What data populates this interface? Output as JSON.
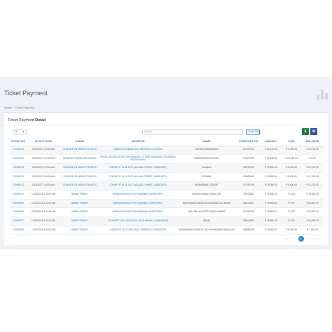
{
  "page": {
    "title": "Ticket Payment",
    "breadcrumb": {
      "home": "Home",
      "separator": "/",
      "current": "Ticket Payment"
    }
  },
  "card": {
    "title_prefix": "Ticket Payment",
    "title_bold": "Detail"
  },
  "controls": {
    "page_size": "10",
    "search_placeholder": "Search",
    "show_all_label": "Show All",
    "excel_icon": "excel-icon",
    "word_icon": "word-icon",
    "excel_glyph": "X",
    "word_glyph": "W"
  },
  "table": {
    "headers": [
      "TICKET NO",
      "FLIGHT DATE",
      "AGENT",
      "SPONSOR",
      "NAME",
      "PASSPORT NO",
      "AMOUNT",
      "PAID",
      "BALANCE"
    ],
    "rows": [
      {
        "ticket": "TCK00016",
        "date": "1/18/2017 2:10:00 AM",
        "agent": "SUNRISE VS AKBAR TRAVELS",
        "sponsor": "ABDULLAH ABDUL AZIZ IBRAHIM AL-JOHANI",
        "name": "FARHAN MAHAMBAN",
        "passport": "M1017922",
        "amount": "₹ 22,110.00",
        "paid": "₹ 2,400.00",
        "balance": "₹ 19,710.00"
      },
      {
        "ticket": "TCK00015",
        "date": "1/18/2017 7:40:00 AM",
        "agent": "SUNRISE TOURS AND TRAVEL",
        "sponsor": "FAISAL BIN MAHDOOR BIN MANNA AL-OTAIBI (MADINAH C/O AHMAD SALEEM ANS)",
        "name": "NAZAIR BEGUM KHAN",
        "passport": "P3027049",
        "amount": "₹ 25,246.00",
        "paid": "₹ 25,246.00",
        "balance": "₹ 0.00"
      },
      {
        "ticket": "TCK00014",
        "date": "1/18/2017 2:10:00 AM",
        "agent": "SUNRISE VS AKBAR TRAVELS",
        "sponsor": "LODHA PP 16.01.2017 (AN AJUL THREE CANDIDATE)",
        "name": "SALMAN",
        "passport": "H8752543",
        "amount": "₹ 20,300.00",
        "paid": "₹ 8,600.00",
        "balance": "₹ 11,700.00"
      },
      {
        "ticket": "TCK00013",
        "date": "1/18/2017 2:10:00 AM",
        "agent": "SUNRISE VS AKBAR TRAVELS",
        "sponsor": "LODHA PP 16.01.2017 (AN AJUL THREE CANDIDATE)",
        "name": "RIZWAN",
        "passport": "N3865460",
        "amount": "₹ 20,300.00",
        "paid": "₹ 8,600.00",
        "balance": "₹ 11,700.00"
      },
      {
        "ticket": "TCK00012",
        "date": "1/18/2017 2:10:00 AM",
        "agent": "SUNRISE VS AKBAR TRAVELS",
        "sponsor": "LODHA PP 16.01.2017 (AN AJUL THREE CANDIDATE)",
        "name": "MOHAMMAD TOUSIF",
        "passport": "S7760759",
        "amount": "₹ 20,300.00",
        "paid": "₹ 8,600.00",
        "balance": "₹ 11,700.00"
      },
      {
        "ticket": "TCK00010",
        "date": "12/19/2016 2:10:00 AM",
        "agent": "AKBAR TRAVEL",
        "sponsor": "MOKASA KHALID FOR MADINAH (CATEGORY)",
        "name": "FAIZAN AHMAD SHAKOOR",
        "passport": "P4612882",
        "amount": "₹ 15,500.00",
        "paid": "₹ 0.00",
        "balance": "₹ 15,500.00"
      },
      {
        "ticket": "TCK00009",
        "date": "12/19/2016 2:10:00 AM",
        "agent": "AKBAR TRAVEL",
        "sponsor": "MOKASA KHALID FOR MADINAH (CATEGORY)",
        "name": "MOHAMMAD BASID MOHAMMAD SULEMAN",
        "passport": "M6433327",
        "amount": "₹ 15,500.00",
        "paid": "₹ 0.00",
        "balance": "₹ 15,500.00"
      },
      {
        "ticket": "TCK00008",
        "date": "12/19/2016 2:10:00 AM",
        "agent": "AKBAR TRAVEL",
        "sponsor": "MOKASA KHALID FOR MADINAH (CATEGORY)",
        "name": "ABU TALHA ISHTEYAQUE AHMAD",
        "passport": "M7929169",
        "amount": "₹ 15,500.00",
        "paid": "₹ 0.00",
        "balance": "₹ 15,500.00"
      },
      {
        "ticket": "TCK00007",
        "date": "12/19/2016 2:10:00 AM",
        "agent": "AKBAR TRAVEL",
        "sponsor": "LODHA PP 19.12.2016 (ADIL GHULAMAM 5 CANDIDATE)",
        "name": "SADIQ",
        "passport": "M6814891",
        "amount": "₹ 15,500.00",
        "paid": "₹ 0.00",
        "balance": "₹ 15,500.00"
      },
      {
        "ticket": "TCK00006",
        "date": "12/19/2016 2:10:00 AM",
        "agent": "AKBAR TRAVEL",
        "sponsor": "LODHA PP 19.12.2016 (ADIL FAREED 5 CANDIDATE)",
        "name": "MOHAMMAD AZMATULLAH MOHAMMAD ABDULAH",
        "passport": "N6588438",
        "amount": "₹ 15,500.00",
        "paid": "₹ 8,450.00",
        "balance": "₹ 7,050.00"
      }
    ]
  },
  "pager": {
    "prev": "‹",
    "page": "1",
    "next": "›",
    "first": "«",
    "last": "»"
  },
  "colors": {
    "accent": "#2a7ab0",
    "band": "#eef1f5",
    "excel": "#1f7a3e",
    "word": "#2b5797"
  }
}
